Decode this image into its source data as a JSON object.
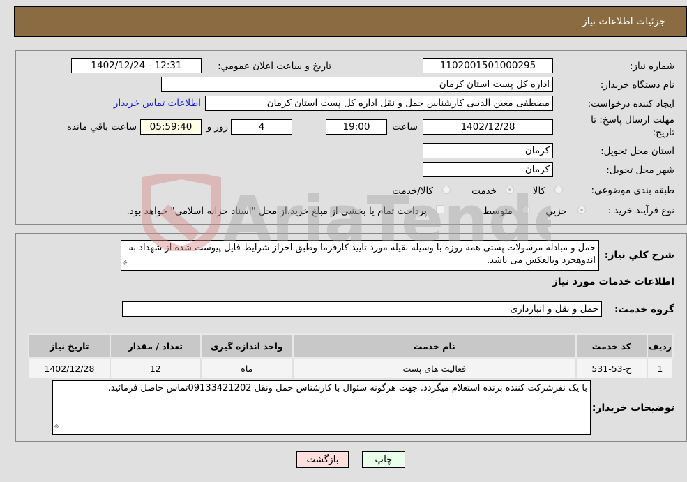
{
  "header": {
    "title": "جزئیات اطلاعات نیاز"
  },
  "details": {
    "need_number_label": "شماره نیاز:",
    "need_number": "1102001501000295",
    "announce_label": "تاريخ و ساعت اعلان عمومي:",
    "announce_value": "1402/12/24 - 12:31",
    "buyer_org_label": "نام دستگاه خريدار:",
    "buyer_org": "اداره کل پست استان کرمان",
    "requester_label": "ايجاد کننده درخواست:",
    "requester": "مصطفی معین الدینی کارشناس حمل و نقل اداره کل پست استان کرمان",
    "contact_link": "اطلاعات تماس خريدار",
    "deadline_label_line1": "مهلت ارسال پاسخ: تا",
    "deadline_label_line2": "تاريخ:",
    "deadline_date": "1402/12/28",
    "time_label": "ساعت",
    "deadline_time": "19:00",
    "days_value": "4",
    "days_label": "روز و",
    "remaining_time": "05:59:40",
    "remaining_label": "ساعت باقي مانده",
    "province_label": "استان محل تحويل:",
    "province": "کرمان",
    "city_label": "شهر محل تحويل:",
    "city": "کرمان",
    "category_label": "طبقه بندی موضوعی:",
    "category_options": [
      "کالا",
      "خدمت",
      "کالا/خدمت"
    ],
    "category_selected": "خدمت",
    "process_label": "نوع فرآيند خريد :",
    "process_options": [
      "جزيي",
      "متوسط"
    ],
    "process_selected": "جزيي",
    "treasury_note": "پرداخت تمام يا بخشی از مبلغ خريد،از محل \"اسناد خزانه اسلامی\" خواهد بود."
  },
  "description": {
    "label": "شرح كلي نياز:",
    "text": "حمل و مبادله مرسولات پستی همه روزه با وسیله نقیله مورد تایید کارفرما  وطبق احراز شرایط فایل پیوست شده از شهداد به اندوهجرد وبالعکس می باشد."
  },
  "services": {
    "section_title": "اطلاعات خدمات مورد نياز",
    "group_label": "گروه خدمت:",
    "group_value": "حمل و نقل و انبارداری",
    "columns": [
      "رديف",
      "کد خدمت",
      "نام خدمت",
      "واحد اندازه گيری",
      "تعداد / مقدار",
      "تاريخ نياز"
    ],
    "rows": [
      [
        "1",
        "ح-53-531",
        "فعاليت های پست",
        "ماه",
        "12",
        "1402/12/28"
      ]
    ]
  },
  "buyer_notes": {
    "label": "توضيحات خريدار:",
    "text": "با یک نفرشرکت کننده برنده استعلام میگردد. جهت هرگونه سئوال با کارشناس حمل ونقل 09133421202تماس حاصل فرمائید."
  },
  "buttons": {
    "print": "چاپ",
    "back": "بازگشت"
  },
  "watermark": {
    "text": "AriaTender.neT"
  }
}
